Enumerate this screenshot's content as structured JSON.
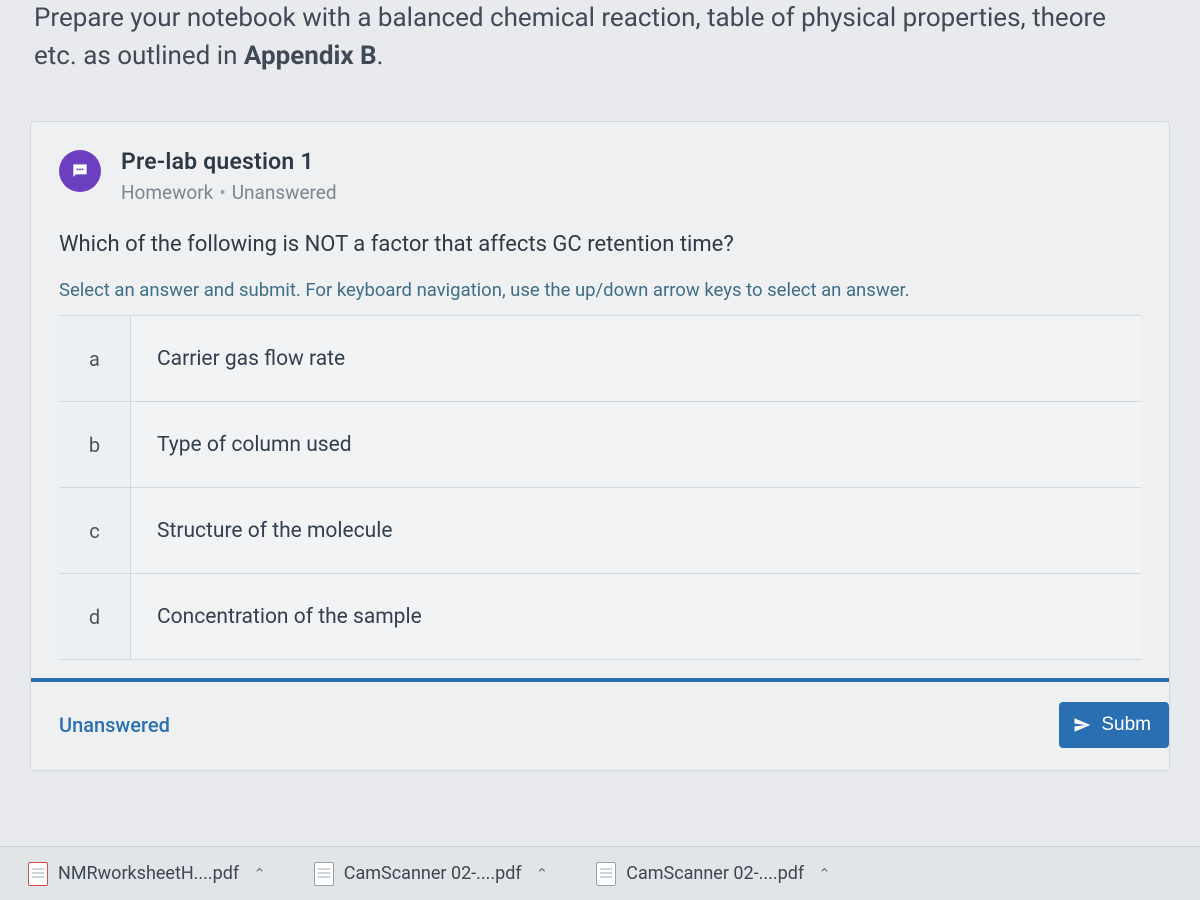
{
  "intro": {
    "line1_pre": "Prepare your notebook with a balanced chemical reaction, table of physical properties, theore",
    "line2_pre": "etc. as outlined in ",
    "line2_bold": "Appendix B",
    "line2_post": "."
  },
  "question": {
    "title": "Pre-lab question 1",
    "category": "Homework",
    "status_tag": "Unanswered",
    "stem": "Which of the following is NOT a factor that affects GC retention time?",
    "instruction": "Select an answer and submit. For keyboard navigation, use the up/down arrow keys to select an answer.",
    "choices": [
      {
        "letter": "a",
        "text": "Carrier gas flow rate"
      },
      {
        "letter": "b",
        "text": "Type of column used"
      },
      {
        "letter": "c",
        "text": "Structure of the molecule"
      },
      {
        "letter": "d",
        "text": "Concentration of the sample"
      }
    ],
    "footer_status": "Unanswered",
    "submit_label": "Subm"
  },
  "downloads": [
    {
      "name": "NMRworksheetH....pdf"
    },
    {
      "name": "CamScanner 02-....pdf"
    },
    {
      "name": "CamScanner 02-....pdf"
    }
  ],
  "colors": {
    "accent": "#2b6fb3",
    "bubble": "#6b3fbf"
  }
}
